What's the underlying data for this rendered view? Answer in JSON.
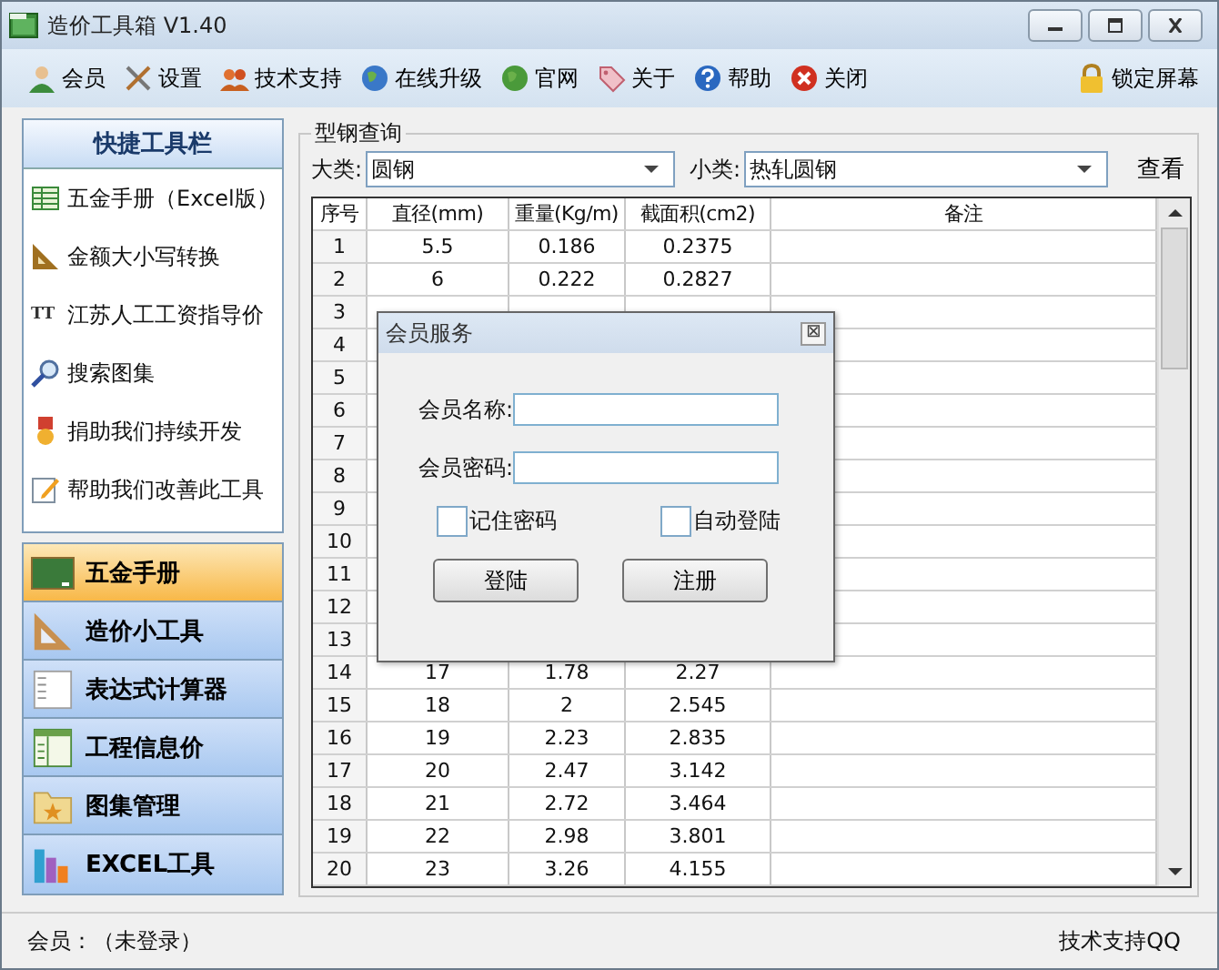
{
  "window": {
    "title": "造价工具箱 V1.40"
  },
  "toolbar": [
    {
      "label": "会员"
    },
    {
      "label": "设置"
    },
    {
      "label": "技术支持"
    },
    {
      "label": "在线升级"
    },
    {
      "label": "官网"
    },
    {
      "label": "关于"
    },
    {
      "label": "帮助"
    },
    {
      "label": "关闭"
    }
  ],
  "lock_button": {
    "label": "锁定屏幕"
  },
  "quick_panel": {
    "title": "快捷工具栏",
    "items": [
      {
        "label": "五金手册（Excel版）"
      },
      {
        "label": "金额大小写转换"
      },
      {
        "label": "江苏人工工资指导价",
        "icon_text": "TT"
      },
      {
        "label": "搜索图集"
      },
      {
        "label": "捐助我们持续开发"
      },
      {
        "label": "帮助我们改善此工具"
      }
    ]
  },
  "nav": [
    {
      "label": "五金手册",
      "selected": true
    },
    {
      "label": "造价小工具",
      "selected": false
    },
    {
      "label": "表达式计算器",
      "selected": false
    },
    {
      "label": "工程信息价",
      "selected": false
    },
    {
      "label": "图集管理",
      "selected": false
    },
    {
      "label": "EXCEL工具",
      "selected": false
    }
  ],
  "query": {
    "title": "型钢查询",
    "category_label": "大类:",
    "category": "圆钢",
    "subcategory_label": "小类:",
    "subcategory": "热轧圆钢",
    "view_button": "查看"
  },
  "table": {
    "columns": [
      "序号",
      "直径(mm)",
      "重量(Kg/m)",
      "截面积(cm2)",
      "备注"
    ],
    "rows": [
      [
        "1",
        "5.5",
        "0.186",
        "0.2375"
      ],
      [
        "2",
        "6",
        "0.222",
        "0.2827"
      ],
      [
        "3"
      ],
      [
        "4"
      ],
      [
        "5"
      ],
      [
        "6"
      ],
      [
        "7"
      ],
      [
        "8"
      ],
      [
        "9"
      ],
      [
        "10"
      ],
      [
        "11"
      ],
      [
        "12"
      ],
      [
        "13"
      ],
      [
        "14",
        "17",
        "1.78",
        "2.27"
      ],
      [
        "15",
        "18",
        "2",
        "2.545"
      ],
      [
        "16",
        "19",
        "2.23",
        "2.835"
      ],
      [
        "17",
        "20",
        "2.47",
        "3.142"
      ],
      [
        "18",
        "21",
        "2.72",
        "3.464"
      ],
      [
        "19",
        "22",
        "2.98",
        "3.801"
      ],
      [
        "20",
        "23",
        "3.26",
        "4.155"
      ]
    ]
  },
  "dialog": {
    "title": "会员服务",
    "close": "⊠",
    "name_label": "会员名称:",
    "password_label": "会员密码:",
    "remember": {
      "label": "记住密码",
      "checked": false
    },
    "auto_login": {
      "label": "自动登陆",
      "checked": false
    },
    "buttons": [
      "登陆",
      "注册"
    ]
  },
  "status_bar": {
    "member": "会员：（未登录）",
    "support": "技术支持QQ"
  }
}
